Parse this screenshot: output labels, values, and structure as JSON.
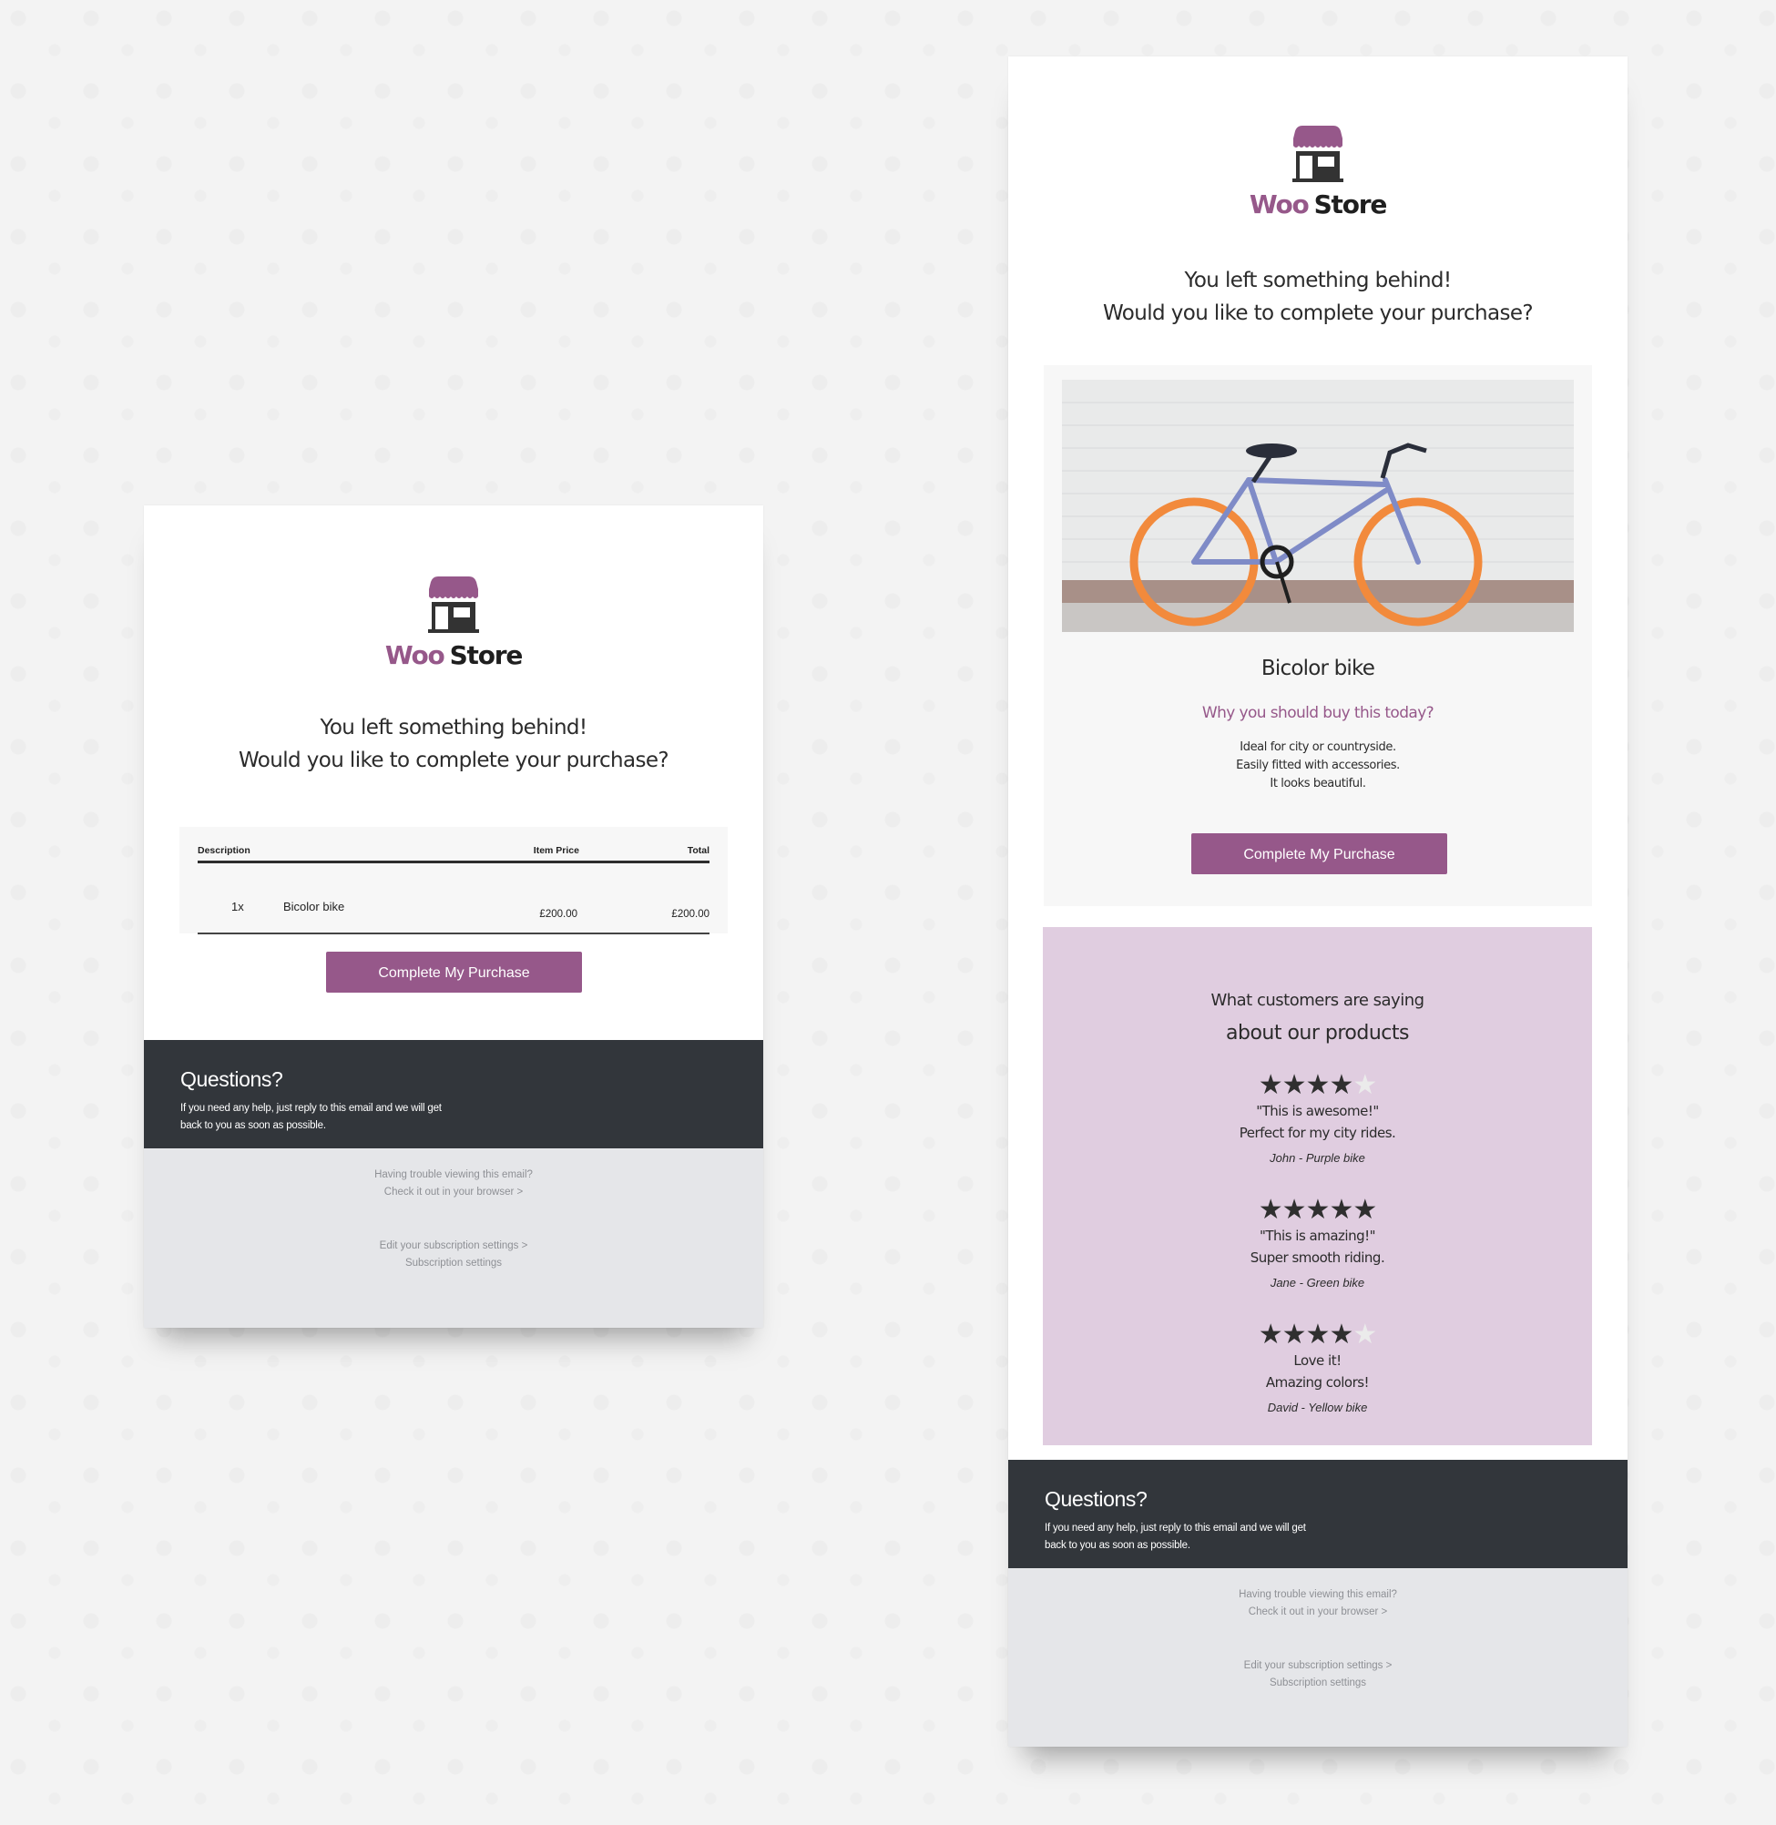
{
  "brand": {
    "part1": "Woo",
    "part2": "Store"
  },
  "colors": {
    "accent": "#96588a",
    "dark_footer": "#32363b",
    "link_footer": "#e5e6e9",
    "review_bg": "#e0cde0",
    "panel_bg": "#f7f7f7"
  },
  "headline": {
    "line1": "You left something behind!",
    "line2": "Would you like to complete your purchase?"
  },
  "email_left": {
    "table": {
      "headers": {
        "description": "Description",
        "item_price": "Item Price",
        "total": "Total"
      },
      "rows": [
        {
          "qty": "1x",
          "name": "Bicolor bike",
          "item_price": "£200.00",
          "total": "£200.00"
        }
      ]
    },
    "cta_label": "Complete My Purchase"
  },
  "email_right": {
    "product": {
      "image_alt": "Bicolor bike photo",
      "title": "Bicolor bike",
      "why": "Why you should buy this today?",
      "points": [
        "Ideal for city or countryside.",
        "Easily fitted with accessories.",
        "It looks beautiful."
      ]
    },
    "cta_label": "Complete My Purchase",
    "reviews": {
      "title_line1": "What customers are saying",
      "title_line2": "about our products",
      "items": [
        {
          "rating": 4,
          "max": 5,
          "quote": "\"This is awesome!\"",
          "body": "Perfect for my city rides.",
          "author": "John - Purple bike"
        },
        {
          "rating": 5,
          "max": 5,
          "quote": "\"This is amazing!\"",
          "body": "Super smooth riding.",
          "author": "Jane - Green bike"
        },
        {
          "rating": 4,
          "max": 5,
          "quote": "Love it!",
          "body": "Amazing colors!",
          "author": "David - Yellow bike"
        }
      ]
    }
  },
  "footer": {
    "questions_title": "Questions?",
    "questions_text": "If you need any help, just reply to this email and we will get back to you as soon as possible.",
    "trouble_line": "Having trouble viewing this email?",
    "browser_link": "Check it out in your browser >",
    "edit_subscription_link": "Edit your subscription settings >",
    "subscription_settings": "Subscription settings"
  },
  "icons": {
    "logo": "storefront-icon",
    "star_on": "★",
    "star_off": "★"
  }
}
